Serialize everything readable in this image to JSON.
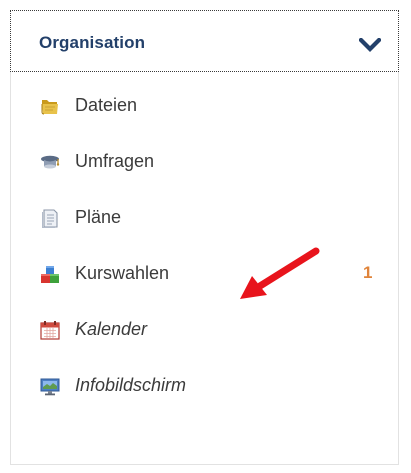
{
  "menu": {
    "header": {
      "title": "Organisation",
      "toggle_icon": "chevron-down-icon"
    },
    "items": [
      {
        "label": "Dateien",
        "icon": "folder-icon",
        "italic": false,
        "badge": ""
      },
      {
        "label": "Umfragen",
        "icon": "survey-icon",
        "italic": false,
        "badge": ""
      },
      {
        "label": "Pläne",
        "icon": "document-icon",
        "italic": false,
        "badge": ""
      },
      {
        "label": "Kurswahlen",
        "icon": "blocks-icon",
        "italic": false,
        "badge": "1"
      },
      {
        "label": "Kalender",
        "icon": "calendar-icon",
        "italic": true,
        "badge": ""
      },
      {
        "label": "Infobildschirm",
        "icon": "monitor-icon",
        "italic": true,
        "badge": ""
      }
    ]
  },
  "colors": {
    "header_text": "#23406a",
    "item_text": "#3b3b3b",
    "badge": "#e0843a",
    "annotation_arrow": "#e8141c"
  }
}
